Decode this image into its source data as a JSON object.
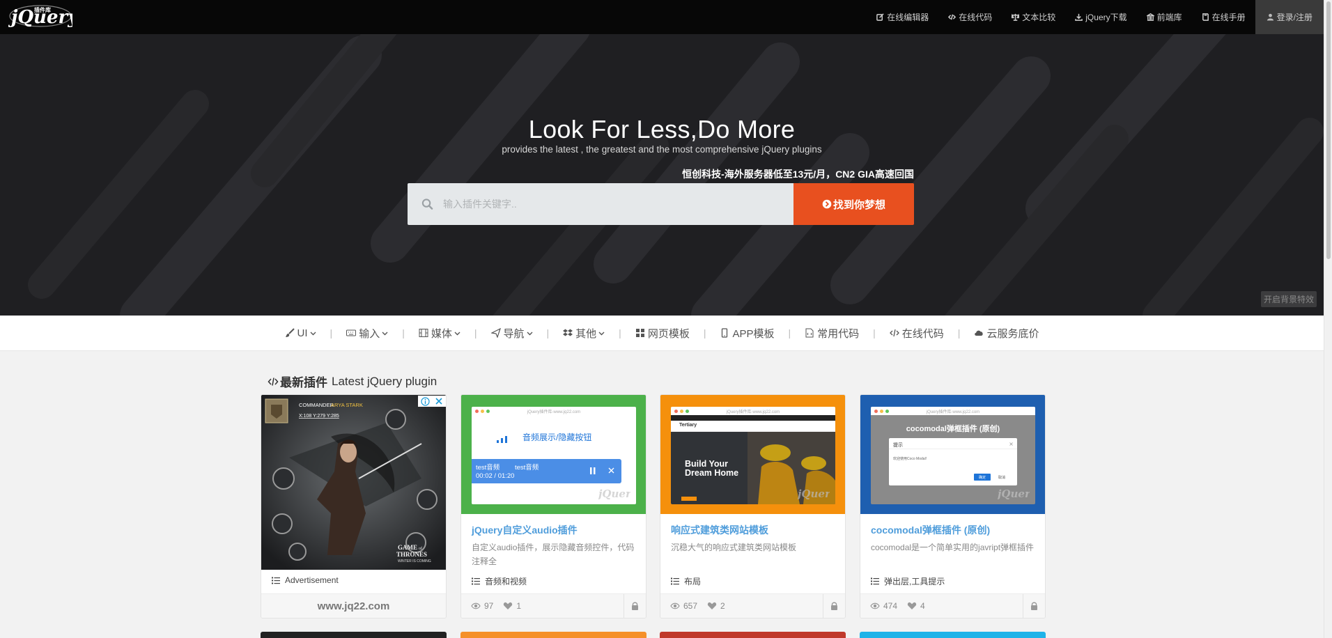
{
  "topnav": {
    "items": [
      {
        "label": "在线编辑器",
        "icon": "edit-icon"
      },
      {
        "label": "在线代码",
        "icon": "code-icon"
      },
      {
        "label": "文本比较",
        "icon": "scale-icon"
      },
      {
        "label": "jQuery下载",
        "icon": "download-icon"
      },
      {
        "label": "前端库",
        "icon": "bank-icon"
      },
      {
        "label": "在线手册",
        "icon": "book-icon"
      }
    ],
    "login": "登录/注册"
  },
  "hero": {
    "title": "Look For Less,Do More",
    "subtitle": "provides the latest , the greatest and the most comprehensive jQuery plugins",
    "promo": "恒创科技-海外服务器低至13元/月，CN2 GIA高速回国",
    "search_placeholder": "输入插件关键字..",
    "search_button": "找到你梦想",
    "bg_toggle": "开启背景特效"
  },
  "catnav": {
    "items": [
      {
        "label": "UI",
        "dropdown": true,
        "icon": "brush-icon"
      },
      {
        "label": "输入",
        "dropdown": true,
        "icon": "keyboard-icon"
      },
      {
        "label": "媒体",
        "dropdown": true,
        "icon": "film-icon"
      },
      {
        "label": "导航",
        "dropdown": true,
        "icon": "send-icon"
      },
      {
        "label": "其他",
        "dropdown": true,
        "icon": "dropbox-icon"
      },
      {
        "label": "网页模板",
        "dropdown": false,
        "icon": "grid-icon"
      },
      {
        "label": "APP模板",
        "dropdown": false,
        "icon": "mobile-icon"
      },
      {
        "label": "常用代码",
        "dropdown": false,
        "icon": "file-code-icon"
      },
      {
        "label": "在线代码",
        "dropdown": false,
        "icon": "code-icon"
      },
      {
        "label": "云服务底价",
        "dropdown": false,
        "icon": "cloud-icon"
      }
    ]
  },
  "section": {
    "title_cn": "最新插件",
    "title_en": "Latest jQuery plugin"
  },
  "ad_card": {
    "tag": "Advertisement",
    "footer": "www.jq22.com",
    "image_text": {
      "banner_title": "COMMANDER",
      "banner_name": "ARYA STARK",
      "coords": "X:108 Y:279 Y:285",
      "game": "GAME",
      "of": "of",
      "thrones": "THRONES",
      "winter": "WINTER IS COMING"
    }
  },
  "cards": [
    {
      "title": "jQuery自定义audio插件",
      "desc": "自定义audio插件，展示隐藏音频控件，代码注释全",
      "tag": "音频和视频",
      "views": "97",
      "likes": "1",
      "thumb_color": "#4cb14a",
      "preview": {
        "site": "jQuery插件库-www.jq22.com",
        "label": "音频展示/隐藏按钮",
        "track_a": "test音频",
        "track_b": "test音频",
        "time": "00:02 / 01:20"
      }
    },
    {
      "title": "响应式建筑类网站模板",
      "desc": "沉稳大气的响应式建筑类网站模板",
      "tag": "布局",
      "views": "657",
      "likes": "2",
      "thumb_color": "#f5900c",
      "preview": {
        "site": "jQuery插件库-www.jq22.com",
        "brand": "Tertiary",
        "headline_1": "Build Your",
        "headline_2": "Dream Home"
      }
    },
    {
      "title": "cocomodal弹框插件 (原创)",
      "desc": "cocomodal是一个简单实用的javript弹框插件",
      "tag": "弹出层,工具提示",
      "views": "474",
      "likes": "4",
      "thumb_color": "#1e5fb0",
      "preview": {
        "site": "jQuery插件库-www.jq22.com",
        "heading": "cocomodal弹框插件 (原创)",
        "modal_title": "提示",
        "modal_body": "欢迎使用Coco Modal!",
        "ok": "确定",
        "cancel": "取消"
      }
    }
  ],
  "colors": {
    "accent": "#e8501f",
    "link": "#4f9ddb",
    "topbar": "#070707"
  }
}
